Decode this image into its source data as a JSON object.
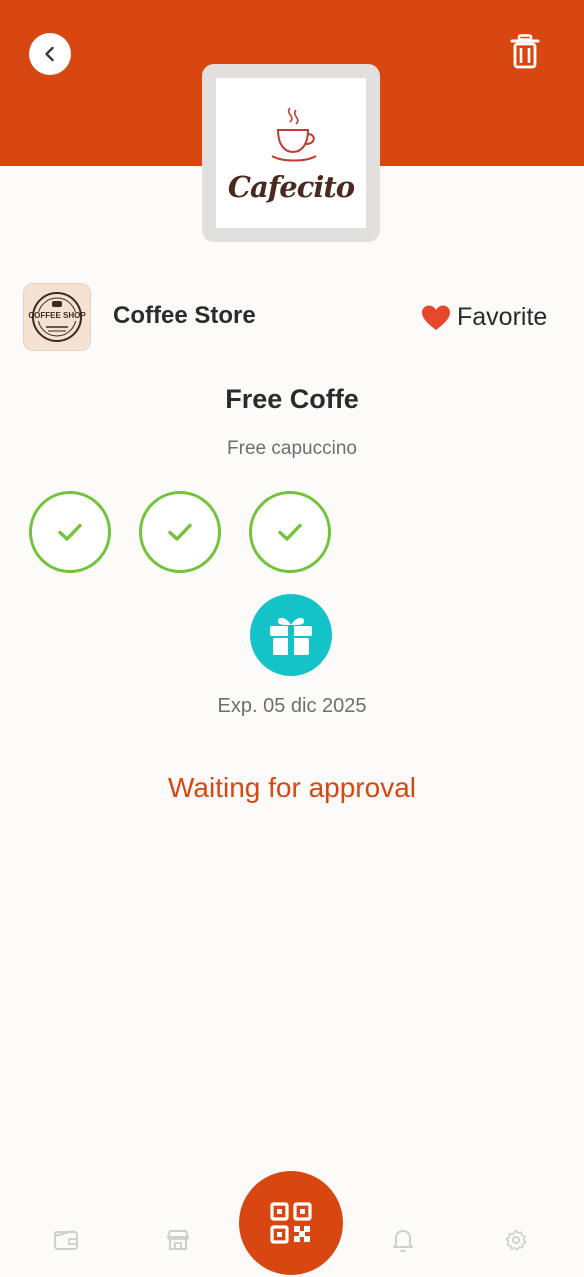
{
  "store": {
    "name": "Coffee Store",
    "logo_text": "Cafecito",
    "avatar_text": "COFFEE SHOP"
  },
  "favorite": {
    "label": "Favorite"
  },
  "promotion": {
    "title": "Free Coffe",
    "description": "Free capuccino",
    "stamps_total": 3,
    "stamps_collected": 3,
    "expiry": "Exp. 05 dic 2025",
    "status": "Waiting for approval"
  },
  "icons": {
    "back": "chevron-left-icon",
    "trash": "trash-icon",
    "favorite": "heart-icon",
    "stamp": "check-icon",
    "reward": "gift-icon",
    "scan": "qr-code-icon",
    "nav": [
      "wallet-icon",
      "store-icon",
      "bell-icon",
      "gear-icon"
    ]
  },
  "colors": {
    "brand": "#d84612",
    "stamp_green": "#72c33a",
    "reward_teal": "#14c3c8",
    "heart": "#e8472b"
  }
}
